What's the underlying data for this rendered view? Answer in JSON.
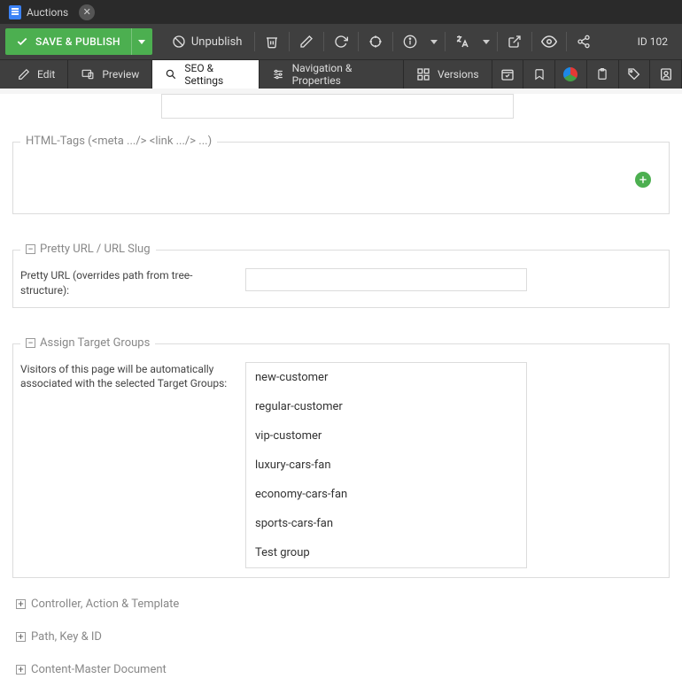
{
  "tab": {
    "title": "Auctions"
  },
  "toolbar": {
    "save": "SAVE & PUBLISH",
    "unpublish": "Unpublish",
    "id": "ID 102"
  },
  "subnav": {
    "edit": "Edit",
    "preview": "Preview",
    "seo": "SEO & Settings",
    "nav": "Navigation & Properties",
    "versions": "Versions"
  },
  "sections": {
    "html_tags_legend": "HTML-Tags (<meta .../> <link .../> ...)",
    "pretty_url_legend": "Pretty URL / URL Slug",
    "pretty_url_label": "Pretty URL (overrides path from tree-structure):",
    "target_groups_legend": "Assign Target Groups",
    "target_groups_desc": "Visitors of this page will be automatically associated with the selected Target Groups:",
    "controller_legend": "Controller, Action & Template",
    "path_legend": "Path, Key & ID",
    "content_master_legend": "Content-Master Document"
  },
  "target_groups": [
    "new-customer",
    "regular-customer",
    "vip-customer",
    "luxury-cars-fan",
    "economy-cars-fan",
    "sports-cars-fan",
    "Test group"
  ]
}
